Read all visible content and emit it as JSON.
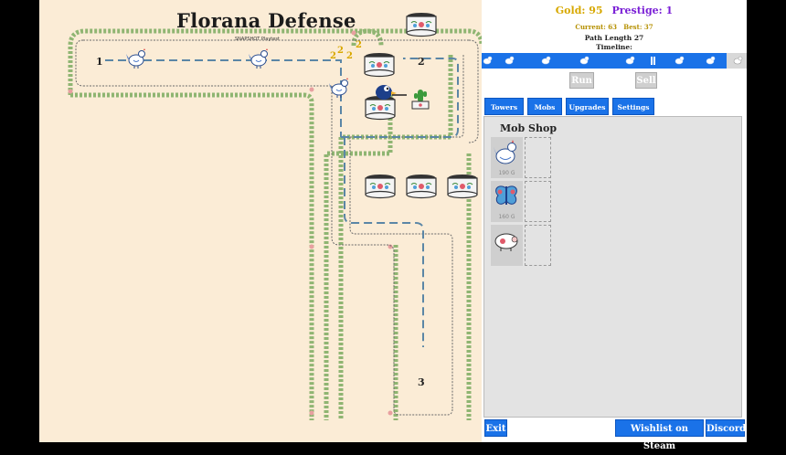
{
  "game": {
    "title": "Florana Defense",
    "subtitle": "SNAPSHOT Playtest",
    "node_labels": [
      "1",
      "2",
      "3"
    ],
    "floating_numbers": [
      "2",
      "2",
      "2",
      "2"
    ]
  },
  "stats": {
    "gold_label": "Gold: 95",
    "prestige_label": "Prestige: 1",
    "current_label": "Current: 63",
    "best_label": "Best: 37",
    "path_length_label": "Path Length 27",
    "timeline_label": "Timeline:"
  },
  "controls": {
    "run_label": "Run",
    "sell_label": "Sell"
  },
  "tabs": [
    {
      "label": "Towers"
    },
    {
      "label": "Mobs"
    },
    {
      "label": "Upgrades"
    },
    {
      "label": "Settings"
    }
  ],
  "shop": {
    "title": "Mob Shop",
    "items": [
      {
        "icon": "chicken-icon",
        "price": "190 G"
      },
      {
        "icon": "butterfly-icon",
        "price": "160 G"
      },
      {
        "icon": "pig-icon",
        "price": ""
      }
    ]
  },
  "bottom": {
    "exit_label": "Exit",
    "wishlist_label": "Wishlist on Steam",
    "discord_label": "Discord"
  },
  "colors": {
    "accent_blue": "#1a72e8",
    "gold": "#d7a800",
    "prestige": "#7a1fd6",
    "board_bg": "#fbecd6",
    "vine": "#8fb572"
  }
}
